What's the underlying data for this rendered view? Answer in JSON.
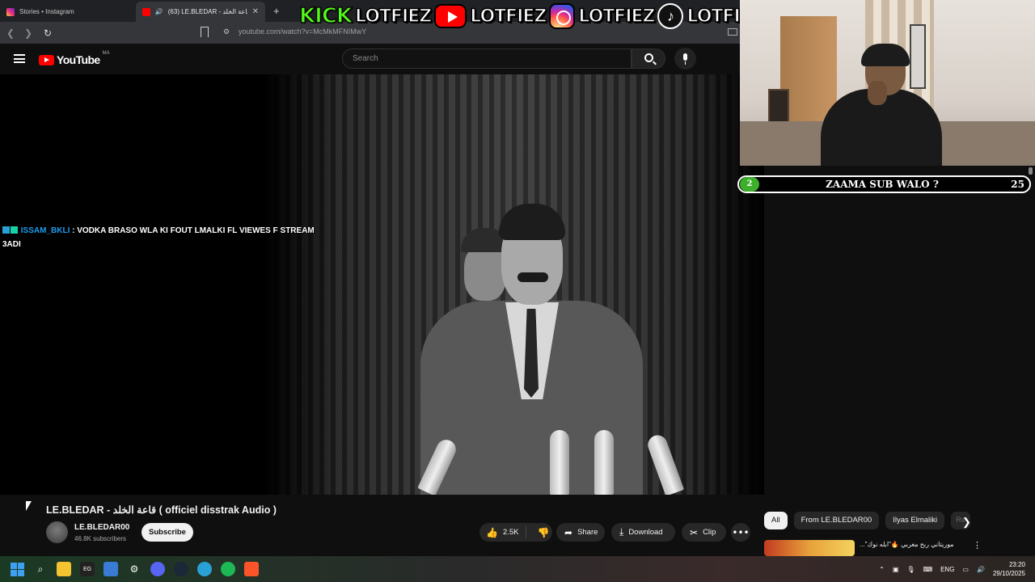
{
  "browser": {
    "tabs": [
      {
        "label": "Stories • Instagram",
        "active": false
      },
      {
        "label": "(63) LE.BLEDAR - قاعة الخلد ( o",
        "active": true
      }
    ],
    "new_tab": "+",
    "url": "youtube.com/watch?v=McMkMFNIMwY"
  },
  "banner": {
    "kick": "KICK",
    "names": [
      "LOTFIEZ",
      "LOTFIEZ",
      "LOTFIEZ",
      "LOTFIEZ"
    ]
  },
  "youtube": {
    "logo": "YouTube",
    "country": "MA",
    "search_placeholder": "Search"
  },
  "chat": {
    "user": "ISSAM_BKLI",
    "message": ": VODKA BRASO WLA KI FOUT LMALKI FL VIEWES F STREAM 3ADI"
  },
  "poll": {
    "number": "2",
    "question": "ZAAMA SUB WALO ?",
    "count": "25",
    "accent": "#3cb02a"
  },
  "video": {
    "title": "LE.BLEDAR - قاعة الخلد ( officiel disstrak Audio )",
    "channel": "LE.BLEDAR00",
    "subscribers": "46.8K subscribers",
    "subscribe_label": "Subscribe",
    "likes": "2.5K",
    "share_label": "Share",
    "download_label": "Download",
    "clip_label": "Clip"
  },
  "chips": [
    "All",
    "From LE.BLEDAR00",
    "Ilyas Elmaliki",
    "Re"
  ],
  "recommended": {
    "title": "موريتاني ربح مغربي 🔥\"ابله نوك\"..."
  },
  "taskbar": {
    "language": "ENG",
    "time": "23:20",
    "date": "29/10/2025"
  },
  "colors": {
    "youtube_red": "#ff0000",
    "kick_green": "#53fc18",
    "chat_user": "#1e9cf0"
  }
}
